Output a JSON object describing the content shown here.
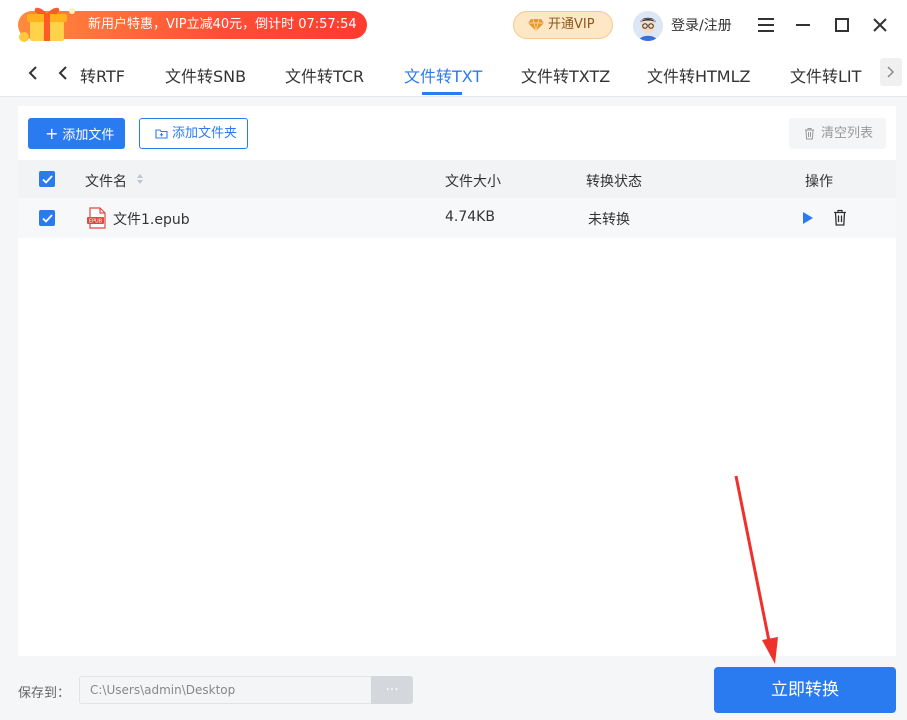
{
  "header": {
    "promo_text": "新用户特惠，VIP立减40元，倒计时 07:57:54",
    "vip_label": "开通VIP",
    "login_label": "登录/注册",
    "icons": [
      "gift-icon",
      "diamond-icon",
      "avatar",
      "menu-icon",
      "minimize-icon",
      "maximize-icon",
      "close-icon"
    ]
  },
  "tabs": {
    "items": [
      {
        "label": "文件转RTF",
        "visible_label": "转RTF"
      },
      {
        "label": "文件转SNB"
      },
      {
        "label": "文件转TCR"
      },
      {
        "label": "文件转TXT",
        "active": true
      },
      {
        "label": "文件转TXTZ"
      },
      {
        "label": "文件转HTMLZ"
      },
      {
        "label": "文件转LIT"
      }
    ]
  },
  "toolbar": {
    "add_file_label": "添加文件",
    "add_folder_label": "添加文件夹",
    "clear_list_label": "清空列表"
  },
  "table": {
    "columns": [
      "文件名",
      "文件大小",
      "转换状态",
      "操作"
    ],
    "rows": [
      {
        "checked": true,
        "name": "文件1.epub",
        "size": "4.74KB",
        "status": "未转换",
        "file_badge": "EPUB"
      }
    ]
  },
  "footer": {
    "save_to_label": "保存到：",
    "path_value": "C:\\Users\\admin\\Desktop",
    "browse_label": "···",
    "convert_label": "立即转换"
  },
  "colors": {
    "accent": "#2b7bf0",
    "promo_start": "#ff8a3d",
    "promo_end": "#ff3b2f",
    "vip_bg": "#fde7c4",
    "annotation_arrow": "#f0302b"
  }
}
